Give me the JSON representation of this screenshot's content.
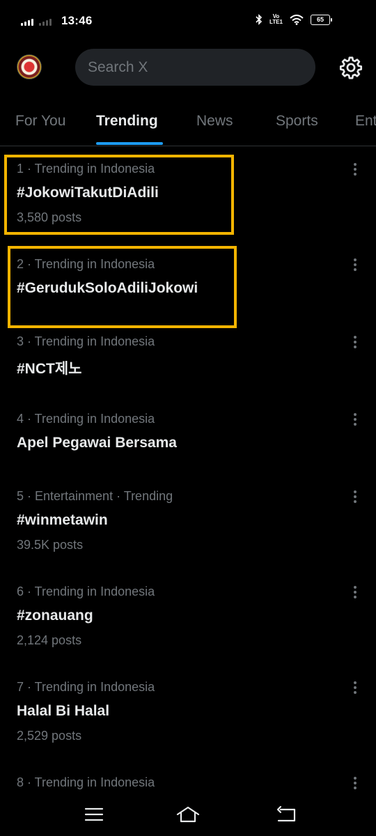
{
  "status_bar": {
    "time": "13:46",
    "network": "Vo LTE1",
    "battery": "65",
    "icons": [
      "signal-icon",
      "signal-icon",
      "bluetooth-icon",
      "volte-icon",
      "wifi-icon",
      "battery-icon"
    ]
  },
  "header": {
    "avatar": "profile-avatar",
    "search_placeholder": "Search X",
    "settings_icon": "gear-icon"
  },
  "tabs": [
    {
      "label": "For You",
      "active": false
    },
    {
      "label": "Trending",
      "active": true
    },
    {
      "label": "News",
      "active": false
    },
    {
      "label": "Sports",
      "active": false
    },
    {
      "label": "Ent",
      "active": false
    }
  ],
  "accent_color": "#1d9bf0",
  "highlight_color": "#f5b400",
  "trends": [
    {
      "meta": "1 · Trending in Indonesia",
      "title": "#JokowiTakutDiAdili",
      "posts": "3,580 posts"
    },
    {
      "meta": "2 · Trending in Indonesia",
      "title": "#GerudukSoloAdiliJokowi",
      "posts": ""
    },
    {
      "meta": "3 · Trending in Indonesia",
      "title": "#NCT제노",
      "posts": ""
    },
    {
      "meta": "4 · Trending in Indonesia",
      "title": "Apel Pegawai Bersama",
      "posts": ""
    },
    {
      "meta": "5 · Entertainment · Trending",
      "title": "#winmetawin",
      "posts": "39.5K posts"
    },
    {
      "meta": "6 · Trending in Indonesia",
      "title": "#zonauang",
      "posts": "2,124 posts"
    },
    {
      "meta": "7 · Trending in Indonesia",
      "title": "Halal Bi Halal",
      "posts": "2,529 posts"
    },
    {
      "meta": "8 · Trending in Indonesia",
      "title": "",
      "posts": ""
    }
  ],
  "nav_bar": {
    "icons": [
      "menu-icon",
      "home-icon",
      "back-icon"
    ]
  }
}
